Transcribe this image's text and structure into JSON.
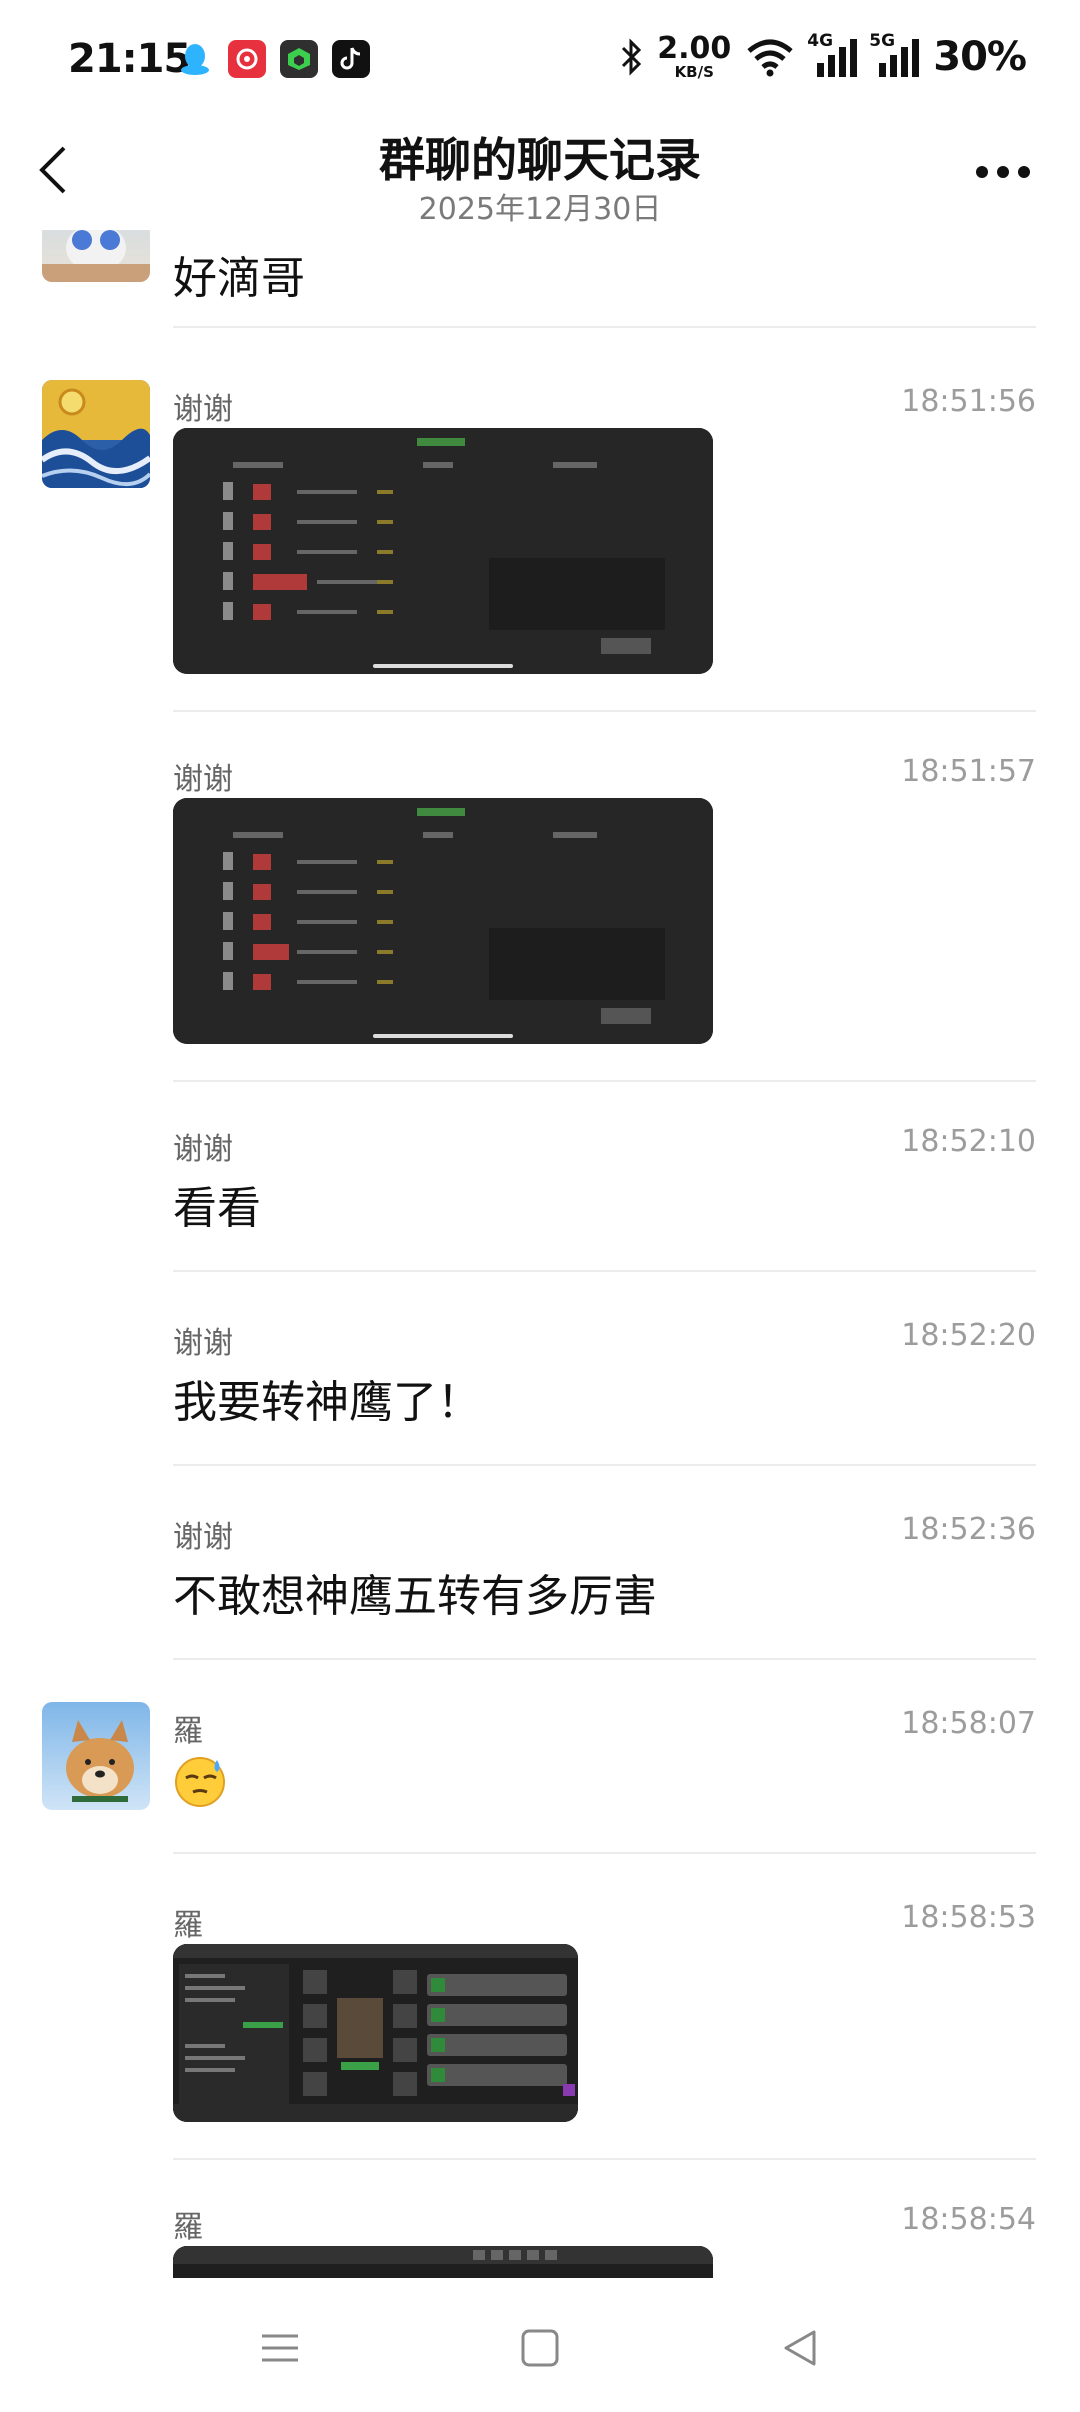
{
  "status_bar": {
    "time": "21:15",
    "net_speed_value": "2.00",
    "net_speed_unit": "KB/S",
    "sim1_label": "4G",
    "sim2_label": "5G",
    "battery": "30%",
    "icons": [
      "qq-icon",
      "xiaohongshu-icon",
      "green-cube-app-icon",
      "tiktok-icon",
      "bluetooth-icon",
      "wifi-icon"
    ]
  },
  "header": {
    "title": "群聊的聊天记录",
    "subtitle": "2025年12月30日"
  },
  "messages": [
    {
      "sender": "",
      "time": "",
      "text": "好滴哥",
      "type": "text"
    },
    {
      "sender": "谢谢",
      "time": "18:51:56",
      "type": "image"
    },
    {
      "sender": "谢谢",
      "time": "18:51:57",
      "type": "image"
    },
    {
      "sender": "谢谢",
      "time": "18:52:10",
      "text": "看看",
      "type": "text"
    },
    {
      "sender": "谢谢",
      "time": "18:52:20",
      "text": "我要转神鹰了！",
      "type": "text"
    },
    {
      "sender": "谢谢",
      "time": "18:52:36",
      "text": "不敢想神鹰五转有多厉害",
      "type": "text"
    },
    {
      "sender": "羅",
      "time": "18:58:07",
      "text": "😓",
      "type": "emoji"
    },
    {
      "sender": "羅",
      "time": "18:58:53",
      "type": "image"
    },
    {
      "sender": "羅",
      "time": "18:58:54",
      "type": "image"
    }
  ],
  "colors": {
    "text": "#111111",
    "secondary": "#666666",
    "timestamp": "#9c9c9c",
    "divider": "#ececec",
    "screenshot_bg": "#2a2a2a"
  }
}
